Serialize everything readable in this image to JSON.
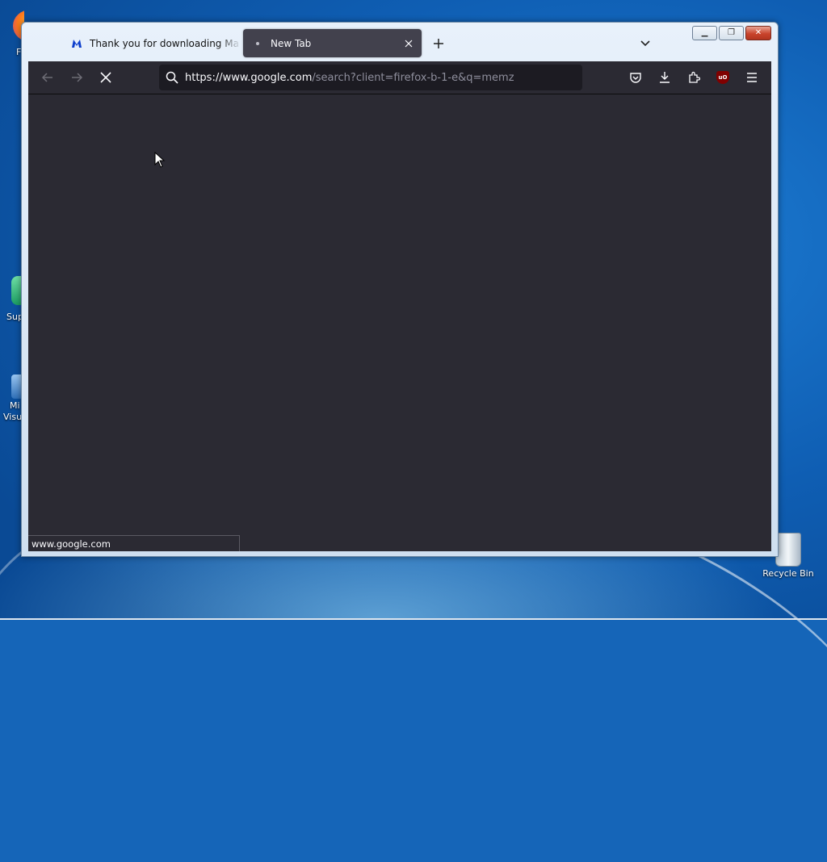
{
  "desktop": {
    "icons": {
      "recycle_bin": "Recycle Bin",
      "left_1": "F",
      "left_2": "Sup",
      "left_3a": "Mi",
      "left_3b": "Visu"
    }
  },
  "browser": {
    "tabs": [
      {
        "title": "Thank you for downloading Ma",
        "favicon": "malwarebytes-icon",
        "active": false
      },
      {
        "title": "New Tab",
        "favicon": "loading-dot-icon",
        "active": true
      }
    ],
    "url": {
      "host": "https://www.google.com",
      "rest": "/search?client=firefox-b-1-e&q=memz"
    },
    "status_text": "www.google.com",
    "toolbar_icons": [
      "back-icon",
      "forward-icon",
      "stop-icon",
      "search-icon",
      "pocket-icon",
      "downloads-icon",
      "extensions-icon",
      "ublock-icon",
      "menu-icon"
    ]
  },
  "colors": {
    "toolbar": "#2b2a33",
    "urlbar": "#1c1b22",
    "active_tab": "#42414d",
    "text": "#fbfbfe"
  }
}
